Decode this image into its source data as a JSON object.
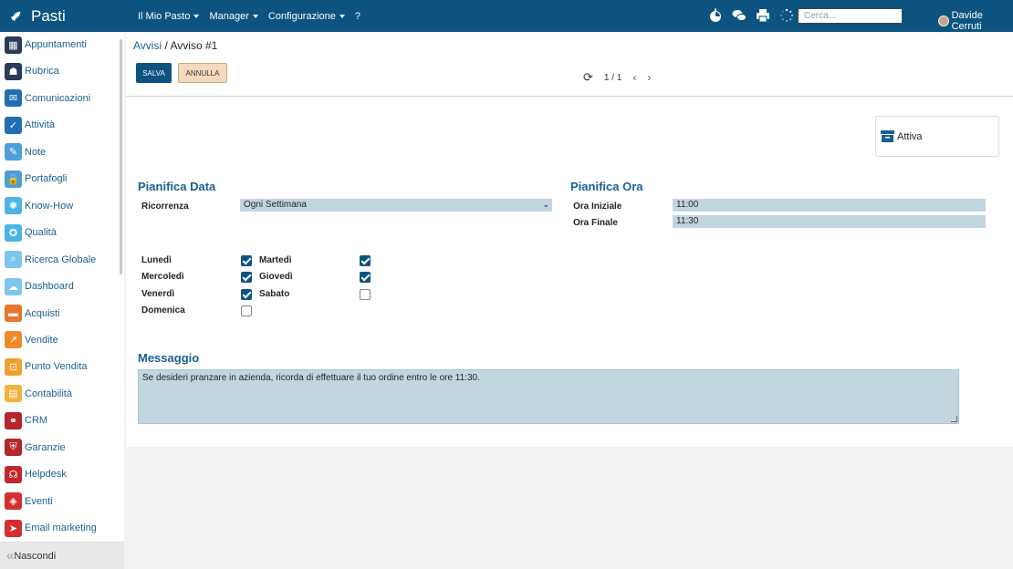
{
  "topbar": {
    "app_title": "Pasti",
    "menu": [
      "Il Mio Pasto",
      "Manager",
      "Configurazione",
      "?"
    ],
    "search_placeholder": "Cerca...",
    "user_name": "Davide Cerruti"
  },
  "sidebar": {
    "items": [
      {
        "label": "Appuntamenti",
        "icon": "calendar-icon",
        "color": "#2b3a55"
      },
      {
        "label": "Rubrica",
        "icon": "address-book-icon",
        "color": "#2b3a55"
      },
      {
        "label": "Comunicazioni",
        "icon": "chat-icon",
        "color": "#1f6fb2"
      },
      {
        "label": "Attività",
        "icon": "check-icon",
        "color": "#1f6fb2"
      },
      {
        "label": "Note",
        "icon": "note-icon",
        "color": "#4d9ed9"
      },
      {
        "label": "Portafogli",
        "icon": "lock-icon",
        "color": "#4d9ed9"
      },
      {
        "label": "Know-How",
        "icon": "bulb-icon",
        "color": "#4db3e6"
      },
      {
        "label": "Qualità",
        "icon": "quality-icon",
        "color": "#4db3e6"
      },
      {
        "label": "Ricerca Globale",
        "icon": "search-icon",
        "color": "#7cc6ee"
      },
      {
        "label": "Dashboard",
        "icon": "dashboard-icon",
        "color": "#7cc6ee"
      },
      {
        "label": "Acquisti",
        "icon": "purchase-icon",
        "color": "#e8772e"
      },
      {
        "label": "Vendite",
        "icon": "chart-icon",
        "color": "#ee8a2a"
      },
      {
        "label": "Punto Vendita",
        "icon": "pos-icon",
        "color": "#f0a030"
      },
      {
        "label": "Contabilità",
        "icon": "ledger-icon",
        "color": "#f3b23a"
      },
      {
        "label": "CRM",
        "icon": "handshake-icon",
        "color": "#b3262a"
      },
      {
        "label": "Garanzie",
        "icon": "shield-icon",
        "color": "#b3262a"
      },
      {
        "label": "Helpdesk",
        "icon": "headset-icon",
        "color": "#c0282c"
      },
      {
        "label": "Eventi",
        "icon": "ticket-icon",
        "color": "#d42f2f"
      },
      {
        "label": "Email marketing",
        "icon": "paper-plane-icon",
        "color": "#d42f2f"
      }
    ],
    "footer_label": "Nascondi"
  },
  "breadcrumb": {
    "parent": "Avvisi",
    "separator": "/",
    "current": "Avviso #1"
  },
  "actions": {
    "save": "SALVA",
    "cancel": "ANNULLA"
  },
  "pager": {
    "value": "1 / 1"
  },
  "stat_button": {
    "label": "Attiva"
  },
  "schedule_date": {
    "title": "Pianifica Data",
    "recurrence_label": "Ricorrenza",
    "recurrence_value": "Ogni Settimana",
    "days": [
      {
        "label": "Lunedì",
        "checked": true
      },
      {
        "label": "Martedì",
        "checked": true
      },
      {
        "label": "Mercoledì",
        "checked": true
      },
      {
        "label": "Giovedì",
        "checked": true
      },
      {
        "label": "Venerdì",
        "checked": true
      },
      {
        "label": "Sabato",
        "checked": false
      },
      {
        "label": "Domenica",
        "checked": false
      }
    ]
  },
  "schedule_time": {
    "title": "Pianifica Ora",
    "start_label": "Ora Iniziale",
    "start_value": "11:00",
    "end_label": "Ora Finale",
    "end_value": "11:30"
  },
  "message": {
    "title": "Messaggio",
    "text": "Se desideri pranzare in azienda, ricorda di effettuare il tuo ordine entro le ore 11:30."
  }
}
